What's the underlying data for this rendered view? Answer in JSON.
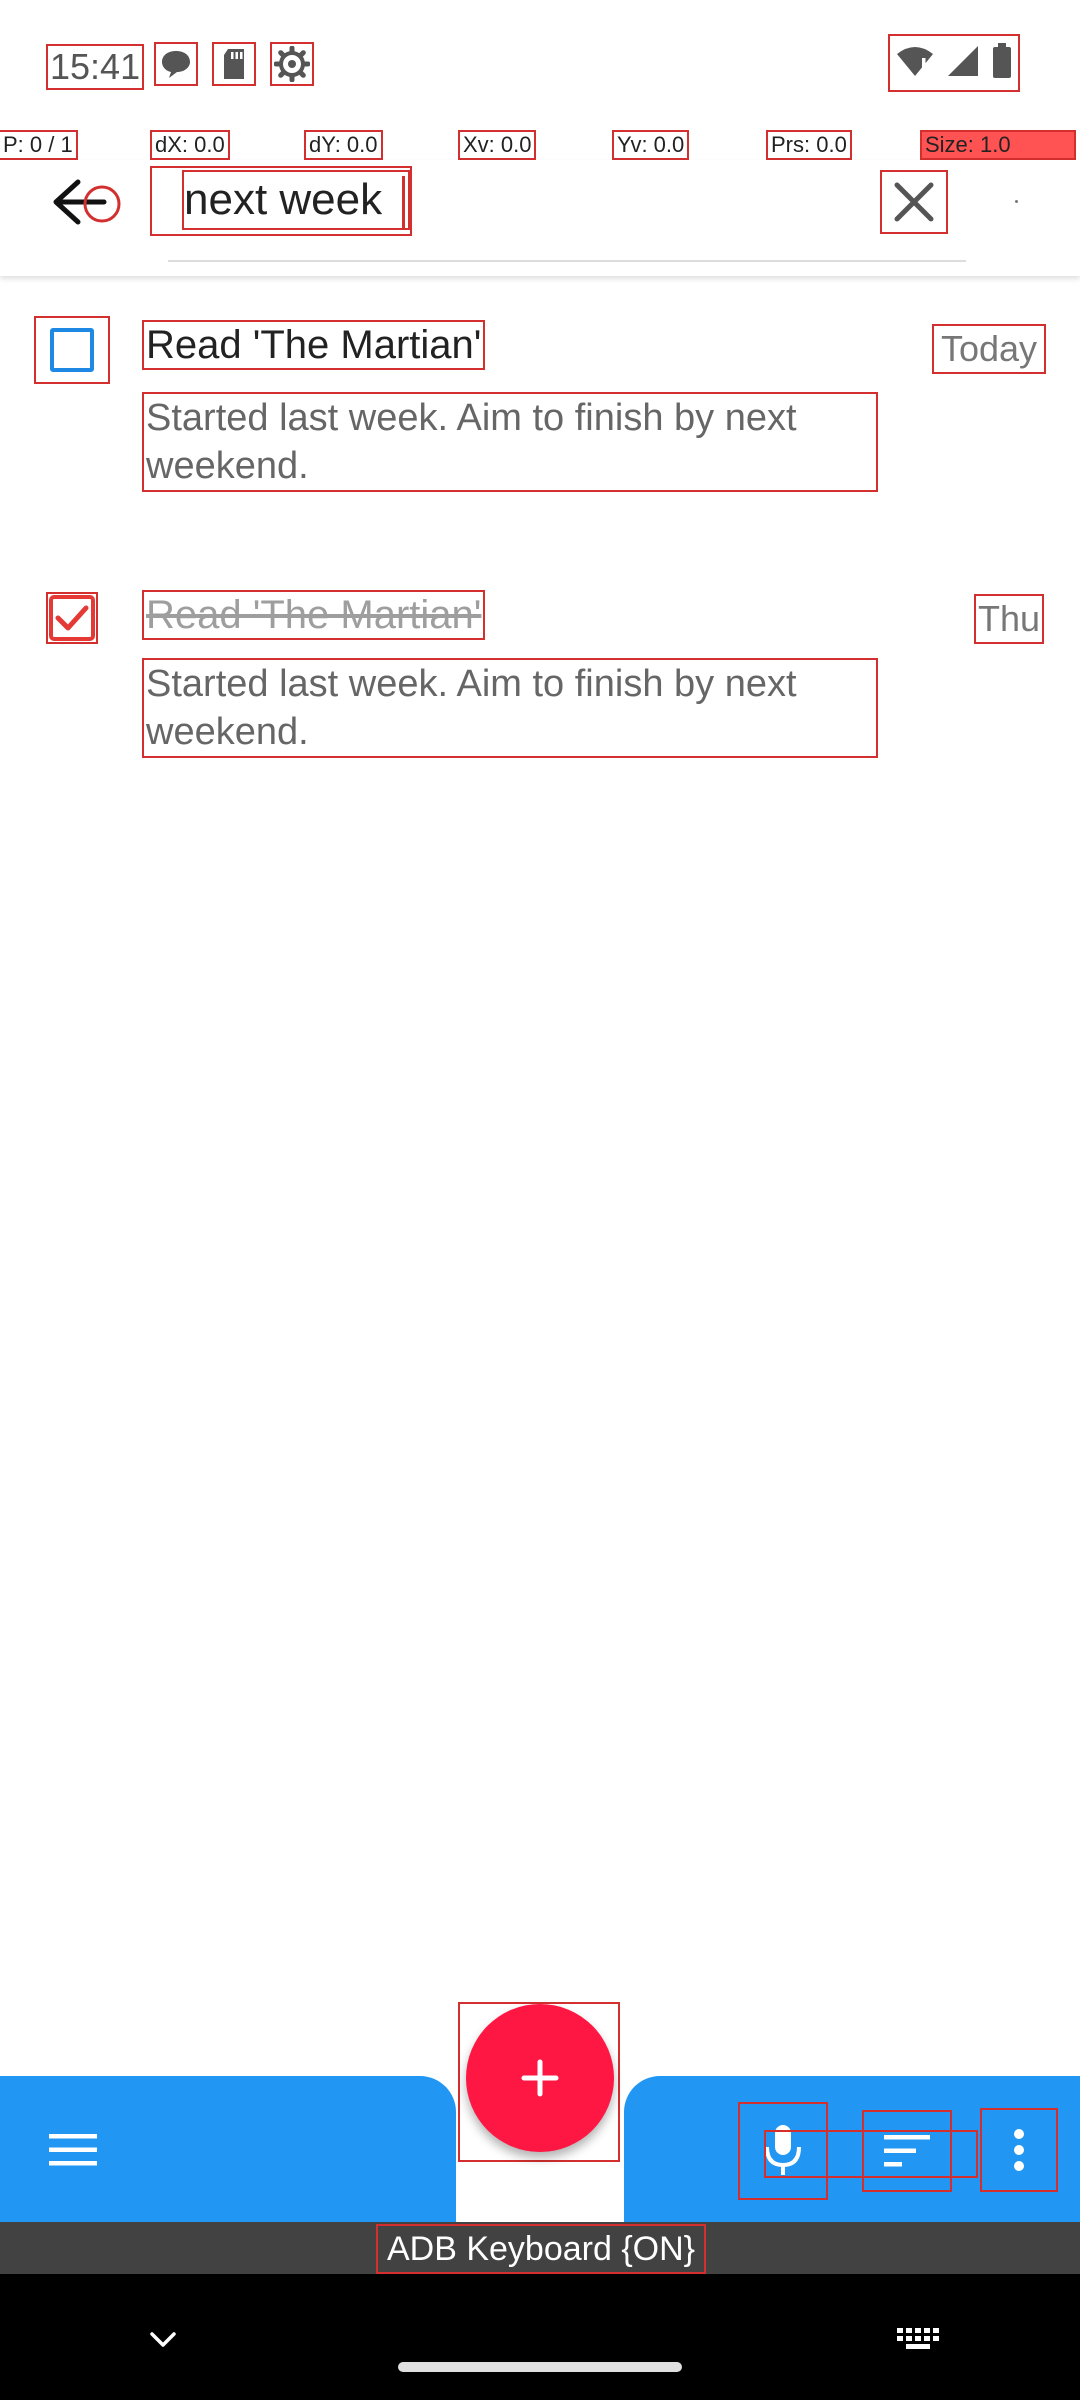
{
  "status_bar": {
    "time": "15:41",
    "icons": [
      "chat-bubble-icon",
      "sd-card-icon",
      "settings-gear-icon",
      "wifi-alert-icon",
      "signal-icon",
      "battery-icon"
    ]
  },
  "pointer_overlay": {
    "p": "P: 0 / 1",
    "dx": "dX: 0.0",
    "dy": "dY: 0.0",
    "xv": "Xv: 0.0",
    "yv": "Yv: 0.0",
    "prs": "Prs: 0.0",
    "size": "Size: 1.0"
  },
  "search": {
    "query": "next week"
  },
  "tasks": [
    {
      "title": "Read 'The Martian'",
      "note": "Started last week. Aim to finish by next weekend.",
      "date": "Today",
      "checked": false
    },
    {
      "title": "Read 'The Martian'",
      "note": "Started last week. Aim to finish by next weekend.",
      "date": "Thu",
      "checked": true
    }
  ],
  "keyboard_indicator": "ADB Keyboard {ON}",
  "colors": {
    "accent_blue": "#2196f3",
    "fab_red": "#ff1744",
    "checked_red": "#e53935",
    "unchecked_blue": "#1e88e5"
  }
}
